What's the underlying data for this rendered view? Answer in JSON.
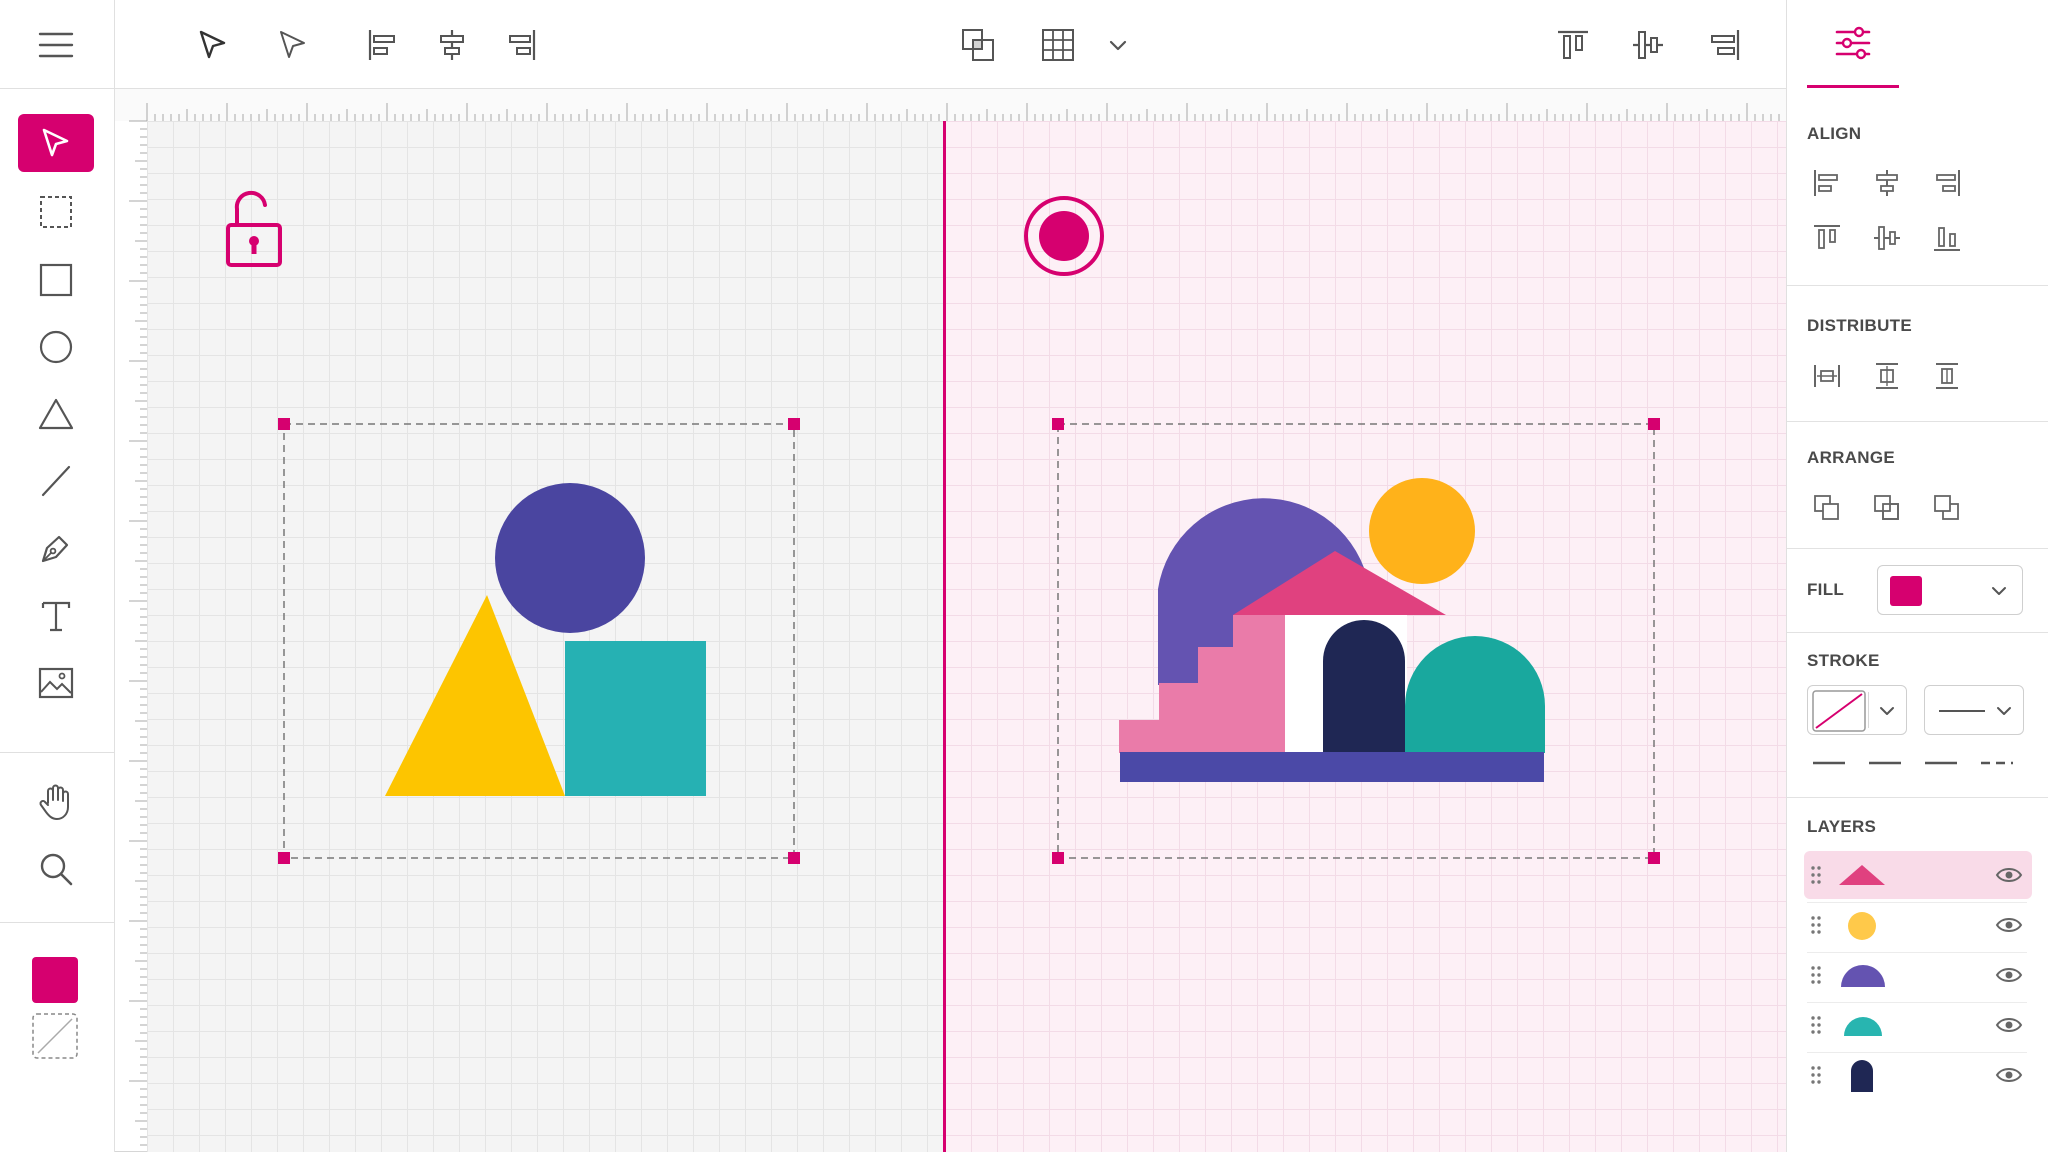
{
  "app": {
    "accent_color": "#d6006f",
    "menu_icon": "hamburger-icon"
  },
  "top_toolbar": {
    "buttons": [
      "select-arrow-icon",
      "direct-select-icon",
      "align-left-icon",
      "align-center-icon",
      "align-right-icon",
      "overlap-squares-icon",
      "grid-icon",
      "chevron-down-icon",
      "align-top-icon",
      "align-middle-icon",
      "align-bottom-icon"
    ]
  },
  "left_toolbar": {
    "tools": [
      "select",
      "marquee",
      "rectangle",
      "ellipse",
      "triangle",
      "line",
      "pen",
      "text",
      "image"
    ],
    "view_tools": [
      "hand",
      "zoom"
    ],
    "fill_color": "#d6006f",
    "stroke": "none"
  },
  "canvas": {
    "left_artboard": {
      "background": "#f4f4f4",
      "badge": "unlock-icon",
      "shapes": [
        {
          "type": "circle",
          "color": "#4a45a0"
        },
        {
          "type": "triangle",
          "color": "#fdc500"
        },
        {
          "type": "square",
          "color": "#26b1b3"
        }
      ]
    },
    "right_artboard": {
      "background": "#fdf0f6",
      "badge": "record-icon",
      "illustration": "house-scene",
      "colors": [
        "#6453b1",
        "#e0417f",
        "#ffb21a",
        "#1f2754",
        "#19a89e",
        "#4b49a7",
        "#ea7ba9"
      ]
    }
  },
  "panel": {
    "tab_icon": "sliders-icon",
    "align": {
      "title": "ALIGN"
    },
    "distribute": {
      "title": "DISTRIBUTE"
    },
    "arrange": {
      "title": "ARRANGE"
    },
    "fill": {
      "label": "FILL",
      "color": "#d6006f"
    },
    "stroke": {
      "label": "STROKE",
      "color": "none",
      "style": "solid"
    },
    "layers": {
      "title": "LAYERS",
      "items": [
        {
          "icon": "triangle",
          "color": "#e0417f",
          "visible": true,
          "selected": true
        },
        {
          "icon": "circle",
          "color": "#ffc94a",
          "visible": true
        },
        {
          "icon": "half-circle",
          "color": "#6453b1",
          "visible": true
        },
        {
          "icon": "half-circle",
          "color": "#28b5b0",
          "visible": true
        },
        {
          "icon": "door",
          "color": "#1f2754",
          "visible": true
        }
      ]
    }
  }
}
